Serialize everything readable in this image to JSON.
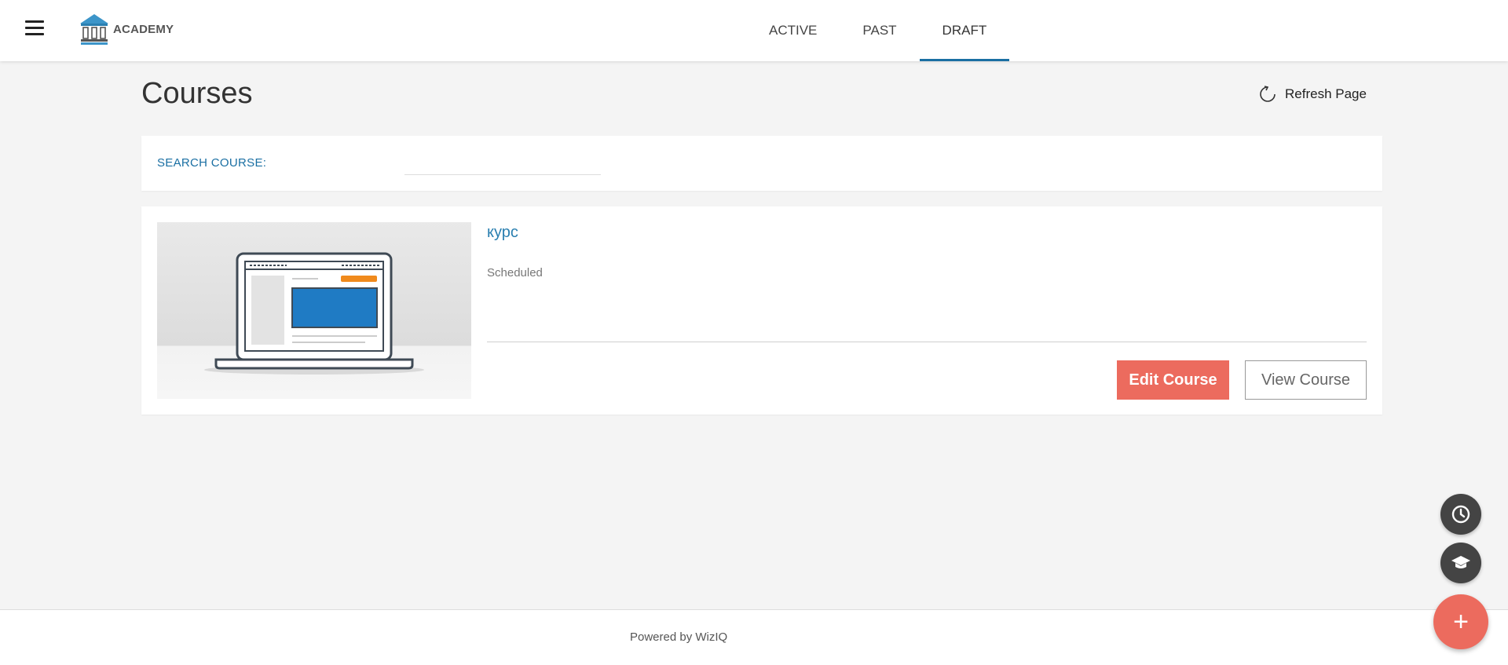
{
  "header": {
    "logo_text": "ACADEMY",
    "tabs": [
      {
        "label": "ACTIVE",
        "active": false
      },
      {
        "label": "PAST",
        "active": false
      },
      {
        "label": "DRAFT",
        "active": true
      }
    ]
  },
  "page": {
    "title": "Courses",
    "refresh_label": "Refresh Page"
  },
  "search": {
    "label": "SEARCH COURSE:",
    "value": "",
    "placeholder": ""
  },
  "courses": [
    {
      "title": "курс",
      "status": "Scheduled",
      "edit_label": "Edit Course",
      "view_label": "View Course"
    }
  ],
  "footer": {
    "text": "Powered by WizIQ"
  },
  "fabs": {
    "add_label": "+"
  },
  "colors": {
    "accent_blue": "#1a6fa3",
    "link_blue": "#2a7fb0",
    "primary_red": "#ec6b5e",
    "fab_dark": "#444444"
  },
  "icons": {
    "menu": "hamburger-icon",
    "logo": "academy-building-icon",
    "refresh": "refresh-icon",
    "clock": "clock-icon",
    "cap": "graduation-cap-icon",
    "add": "plus-icon"
  }
}
